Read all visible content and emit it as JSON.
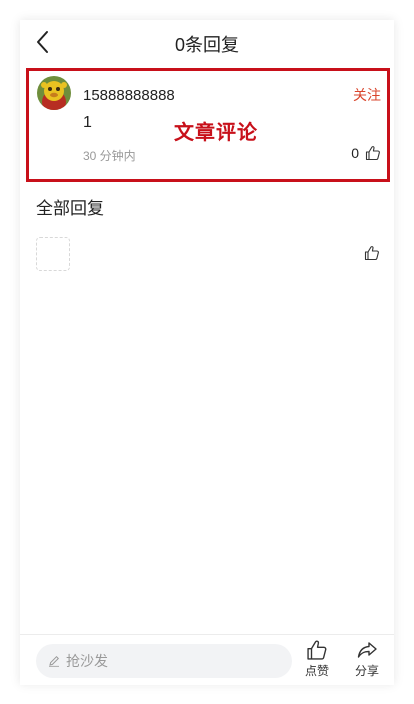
{
  "header": {
    "title": "0条回复"
  },
  "comment": {
    "username": "15888888888",
    "follow_label": "关注",
    "text": "1",
    "annotation": "文章评论",
    "time": "30 分钟内",
    "like_count": "0"
  },
  "replies_section": {
    "title": "全部回复"
  },
  "bottom_bar": {
    "input_placeholder": "抢沙发",
    "like_label": "点赞",
    "share_label": "分享"
  },
  "colors": {
    "accent_red": "#c8101a",
    "follow_orange": "#d9452c"
  },
  "icons": [
    "back-icon",
    "thumbs-up-icon",
    "pencil-icon",
    "share-icon"
  ]
}
